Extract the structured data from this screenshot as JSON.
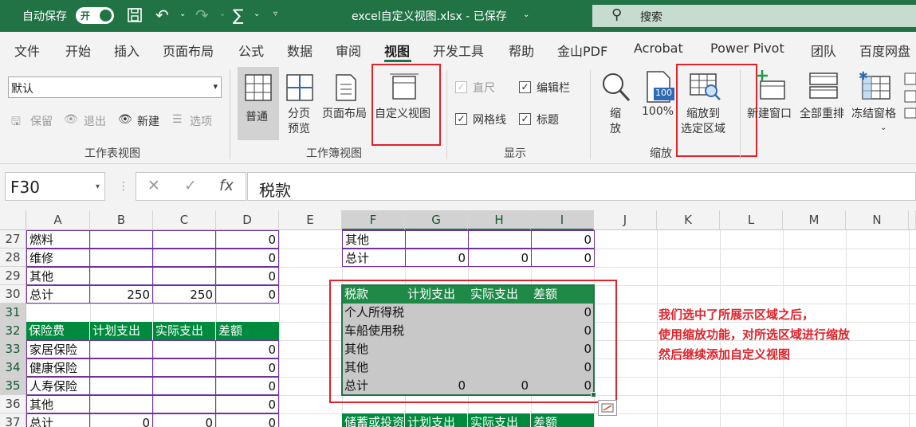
{
  "titlebar": {
    "autosave_label": "自动保存",
    "autosave_state": "开",
    "filename": "excel自定义视图.xlsx - 已保存",
    "search_placeholder": "搜索",
    "accent": "#217346"
  },
  "menu": {
    "tabs": [
      {
        "label": "文件"
      },
      {
        "label": "开始"
      },
      {
        "label": "插入"
      },
      {
        "label": "页面布局"
      },
      {
        "label": "公式"
      },
      {
        "label": "数据"
      },
      {
        "label": "审阅"
      },
      {
        "label": "视图"
      },
      {
        "label": "开发工具"
      },
      {
        "label": "帮助"
      },
      {
        "label": "金山PDF"
      },
      {
        "label": "Acrobat"
      },
      {
        "label": "Power Pivot"
      },
      {
        "label": "团队"
      },
      {
        "label": "百度网盘"
      }
    ],
    "active": "视图"
  },
  "ribbon": {
    "sheet_view": {
      "dropdown_value": "默认",
      "keep": "保留",
      "exit": "退出",
      "new": "新建",
      "options": "选项",
      "group_label": "工作表视图"
    },
    "workbook_views": {
      "normal": "普通",
      "page_break_1": "分页",
      "page_break_2": "预览",
      "page_layout": "页面布局",
      "custom_views": "自定义视图",
      "group_label": "工作簿视图"
    },
    "show": {
      "ruler": "直尺",
      "formula_bar": "编辑栏",
      "gridlines": "网格线",
      "headings": "标题",
      "group_label": "显示"
    },
    "zoom": {
      "zoom_1": "缩",
      "zoom_2": "放",
      "hundred_icon_text": "100",
      "hundred": "100%",
      "zoom_to_sel_1": "缩放到",
      "zoom_to_sel_2": "选定区域",
      "group_label": "缩放"
    },
    "window": {
      "new_window": "新建窗口",
      "arrange_all": "全部重排",
      "freeze_panes": "冻结窗格"
    }
  },
  "formula_bar": {
    "name_box": "F30",
    "fx": "fx",
    "content": "税款"
  },
  "grid": {
    "columns": [
      "A",
      "B",
      "C",
      "D",
      "E",
      "F",
      "G",
      "H",
      "I",
      "J",
      "K",
      "L",
      "M",
      "N"
    ],
    "rows": [
      "27",
      "28",
      "29",
      "30",
      "31",
      "32",
      "33",
      "34",
      "35",
      "36",
      "37"
    ],
    "left_table": [
      {
        "a": "燃料",
        "b": "",
        "c": "",
        "d": "0"
      },
      {
        "a": "维修",
        "b": "",
        "c": "",
        "d": "0"
      },
      {
        "a": "其他",
        "b": "",
        "c": "",
        "d": "0"
      },
      {
        "a": "总计",
        "b": "250",
        "c": "250",
        "d": "0"
      },
      {
        "a": "",
        "b": "",
        "c": "",
        "d": ""
      },
      {
        "a": "保险费",
        "b": "计划支出",
        "c": "实际支出",
        "d": "差额"
      },
      {
        "a": "家居保险",
        "b": "",
        "c": "",
        "d": "0"
      },
      {
        "a": "健康保险",
        "b": "",
        "c": "",
        "d": "0"
      },
      {
        "a": "人寿保险",
        "b": "",
        "c": "",
        "d": "0"
      },
      {
        "a": "其他",
        "b": "",
        "c": "",
        "d": "0"
      },
      {
        "a": "总计",
        "b": "0",
        "c": "0",
        "d": "0"
      }
    ],
    "right_top": [
      {
        "f": "其他",
        "g": "",
        "h": "",
        "i": "0"
      },
      {
        "f": "总计",
        "g": "0",
        "h": "0",
        "i": "0"
      }
    ],
    "tax_table": {
      "header": [
        "税款",
        "计划支出",
        "实际支出",
        "差额"
      ],
      "rows": [
        {
          "f": "个人所得税",
          "g": "",
          "h": "",
          "i": "0"
        },
        {
          "f": "车船使用税",
          "g": "",
          "h": "",
          "i": "0"
        },
        {
          "f": "其他",
          "g": "",
          "h": "",
          "i": "0"
        },
        {
          "f": "其他",
          "g": "",
          "h": "",
          "i": "0"
        },
        {
          "f": "总计",
          "g": "0",
          "h": "0",
          "i": "0"
        }
      ]
    },
    "savings_header": [
      "储蓄或投资",
      "计划支出",
      "实际支出",
      "差额"
    ]
  },
  "annotation": {
    "line1": "我们选中了所展示区域之后，",
    "line2": "使用缩放功能，对所选区域进行缩放",
    "line3": "然后继续添加自定义视图",
    "color": "#e0222a"
  }
}
